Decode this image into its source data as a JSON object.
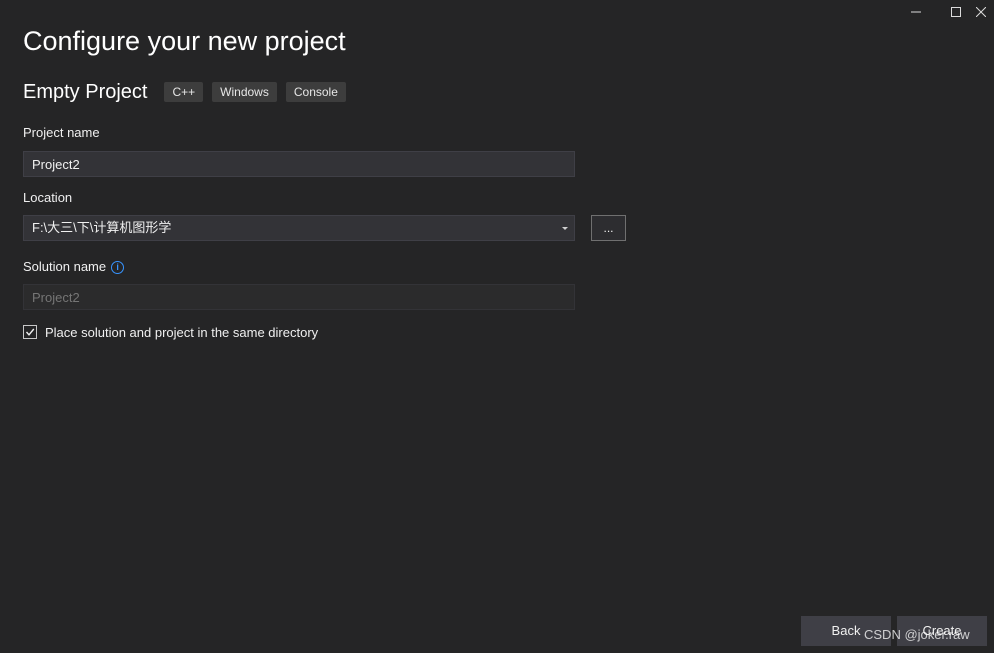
{
  "dialog": {
    "title": "Configure your new project",
    "template_name": "Empty Project",
    "tags": [
      "C++",
      "Windows",
      "Console"
    ]
  },
  "project_name": {
    "label": "Project name",
    "value": "Project2"
  },
  "location": {
    "label": "Location",
    "value": "F:\\大三\\下\\计算机图形学",
    "browse_label": "..."
  },
  "solution_name": {
    "label": "Solution name",
    "placeholder": "Project2"
  },
  "same_directory": {
    "label": "Place solution and project in the same directory",
    "checked": true
  },
  "footer": {
    "back_label": "Back",
    "create_label": "Create"
  },
  "watermark": "CSDN @joker.raw",
  "colors": {
    "background": "#252526",
    "input": "#333337",
    "button": "#3f3f46",
    "info_accent": "#3794ff"
  },
  "icons": [
    "minimize-icon",
    "maximize-icon",
    "close-icon",
    "info-icon",
    "dropdown-arrow-icon",
    "checkmark-icon"
  ]
}
